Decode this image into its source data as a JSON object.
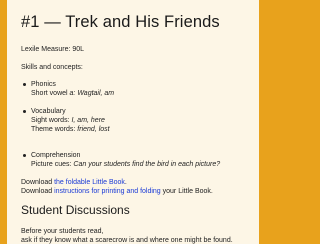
{
  "title": "#1 — Trek and His Friends",
  "lexile": "Lexile Measure: 90L",
  "skills_heading": "Skills and concepts:",
  "skills": [
    {
      "name": "Phonics",
      "detail_prefix": "Short vowel ",
      "detail_em": "a: Wagtail, am",
      "detail2_prefix": "",
      "detail2_em": ""
    },
    {
      "name": "Vocabulary",
      "detail_prefix": "Sight words: ",
      "detail_em": "I, am, here",
      "detail2_prefix": "Theme words: ",
      "detail2_em": "friend, lost"
    },
    {
      "name": "Comprehension",
      "detail_prefix": "Picture cues: ",
      "detail_em": "Can your students find the bird in each picture?",
      "detail2_prefix": "",
      "detail2_em": ""
    }
  ],
  "download1": {
    "prefix": "Download ",
    "link": "the foldable Little Book",
    "suffix": "."
  },
  "download2": {
    "prefix": "Download ",
    "link": "instructions for printing and folding",
    "suffix": " your Little Book."
  },
  "section_title": "Student Discussions",
  "discussion_line1": "Before your students read,",
  "discussion_line2": "ask if they know what a scarecrow is and where one might be found.",
  "colors": {
    "background": "#e8a21c",
    "card": "#fdf6e6",
    "link": "#1a3ad6"
  }
}
